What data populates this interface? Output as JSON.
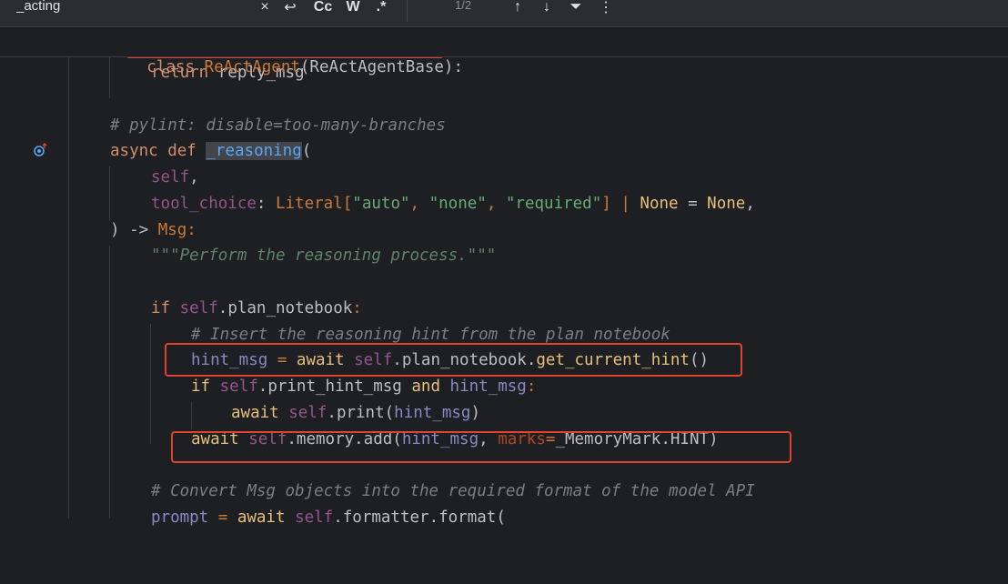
{
  "findbar": {
    "query": "_acting",
    "close_glyph": "×",
    "undo_glyph": "↩",
    "match_case": "Cc",
    "whole_words": "W",
    "regex": ".*",
    "match_count": "1/2",
    "prev_glyph": "↑",
    "next_glyph": "↓",
    "filter_glyph": "⏷",
    "more_glyph": "⋮"
  },
  "code": {
    "sticky": {
      "kw": "class",
      "name": "ReActAgent",
      "rest": "(ReActAgentBase):"
    },
    "return_kw": "return",
    "return_val": "reply_msg",
    "pylint": "# pylint: disable=too-many-branches",
    "async_kw": "async",
    "def_kw": "def",
    "fn_name": "_reasoning",
    "open_paren": "(",
    "self_param": "self",
    "comma": ",",
    "tool_choice": "tool_choice",
    "colon_sp": ": ",
    "literal": "Literal",
    "lit_open": "[",
    "s_auto": "\"auto\"",
    "s_none": "\"none\"",
    "s_required": "\"required\"",
    "lit_close": "]",
    "pipe": " | ",
    "none1": "None",
    "eq": " = ",
    "none2": "None",
    "close_arrow": ") -> ",
    "ret_type": "Msg",
    "colon": ":",
    "docstring": "\"\"\"Perform the reasoning process.\"\"\"",
    "if_kw": "if",
    "self": "self",
    "plan_notebook": ".plan_notebook",
    "cmt_insert": "# Insert the reasoning hint from the plan notebook",
    "hint_msg": "hint_msg",
    "await_kw": "await",
    "get_hint": "get_current_hint",
    "empty_call": "()",
    "print_hint_msg": ".print_hint_msg",
    "and_kw": "and",
    "print_fn": "print",
    "memory_add": ".memory.add(",
    "marks": "marks",
    "eqsign": "=",
    "memmark": "_MemoryMark.HINT)",
    "cmt_convert": "# Convert Msg objects into the required format of the model API",
    "prompt": "prompt",
    "formatter": ".formatter.format("
  }
}
